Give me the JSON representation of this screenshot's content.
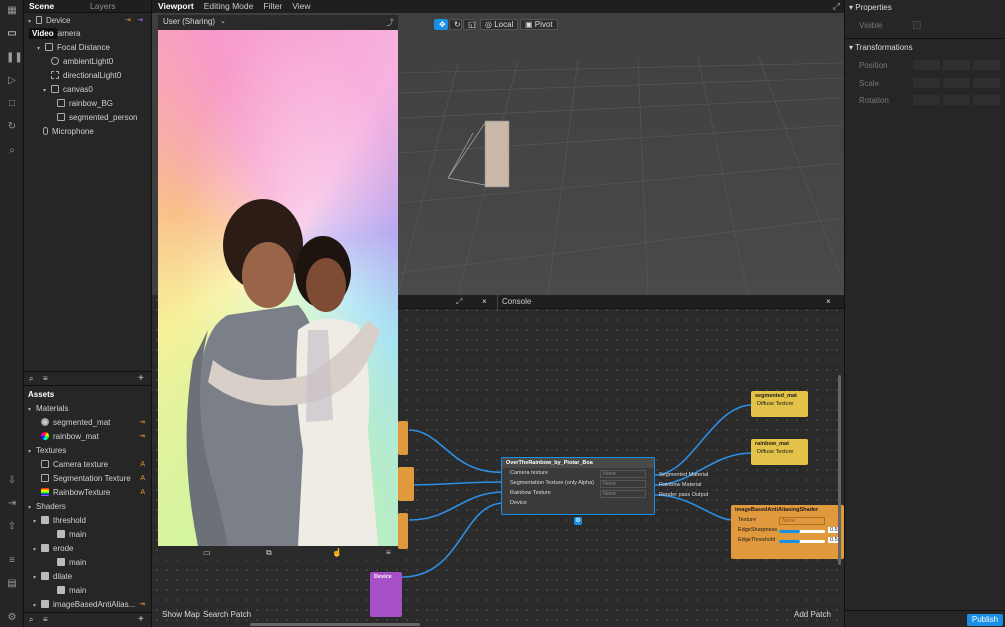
{
  "scene_panel": {
    "tabs": [
      "Scene",
      "Layers"
    ],
    "tree": [
      {
        "label": "Device"
      },
      {
        "label": "Camera"
      },
      {
        "label": "Focal Distance"
      },
      {
        "label": "ambientLight0"
      },
      {
        "label": "directionalLight0"
      },
      {
        "label": "canvas0"
      },
      {
        "label": "rainbow_BG"
      },
      {
        "label": "segmented_person"
      },
      {
        "label": "Microphone"
      }
    ],
    "video_tooltip": "Video"
  },
  "assets": {
    "title": "Assets",
    "materials_label": "Materials",
    "materials": [
      "segmented_mat",
      "rainbow_mat"
    ],
    "textures_label": "Textures",
    "textures": [
      "Camera texture",
      "Segmentation Texture",
      "RainbowTexture"
    ],
    "texture_badge": "A",
    "shaders_label": "Shaders",
    "shaders": [
      "threshold",
      "erode",
      "dilate",
      "imageBasedAntiAlias..."
    ],
    "shader_child": "main"
  },
  "viewport": {
    "tabs": [
      "Viewport",
      "Editing Mode",
      "Filter",
      "View"
    ],
    "local_label": "Local",
    "pivot_label": "Pivot"
  },
  "preview": {
    "device_label": "User (Sharing)"
  },
  "patch_editor": {
    "console_label": "Console",
    "show_map": "Show Map",
    "search_patch": "Search Patch",
    "add_patch": "Add Patch"
  },
  "nodes": {
    "main": {
      "title": "OverTheRainbow_by_Piotar_Boa",
      "inputs": [
        "Camera texture",
        "Segmentation Texture (only Alpha)",
        "Rainbow Texture",
        "Device"
      ],
      "input_values": [
        "None",
        "None",
        "None"
      ],
      "outputs": [
        "Segmented Material",
        "Rainbow Material",
        "Render pass Output"
      ]
    },
    "segmented": {
      "title": "segmented_mat",
      "port": "Diffuse Texture"
    },
    "rainbow": {
      "title": "rainbow_mat",
      "port": "Diffuse Texture"
    },
    "shader": {
      "title": "imageBasedAntiAliasingShader",
      "ports": [
        "Texture",
        "EdgeSharpness",
        "EdgeThreshold"
      ],
      "texture_value": "None",
      "sharpness": "0.5",
      "threshold": "0.5",
      "sharpness_level": 0.45,
      "threshold_level": 0.45
    },
    "device": {
      "title": "Device"
    }
  },
  "properties": {
    "title": "Properties",
    "visible_label": "Visible",
    "transformations_label": "Transformations",
    "rows": [
      "Position",
      "Scale",
      "Rotation"
    ]
  },
  "publish_label": "Publish",
  "colors": {
    "accent": "#1a8fe3",
    "node_orange": "#e09a3d",
    "node_yellow": "#e3c24a",
    "node_purple": "#a64fc6",
    "wire": "#2e8fe6"
  }
}
